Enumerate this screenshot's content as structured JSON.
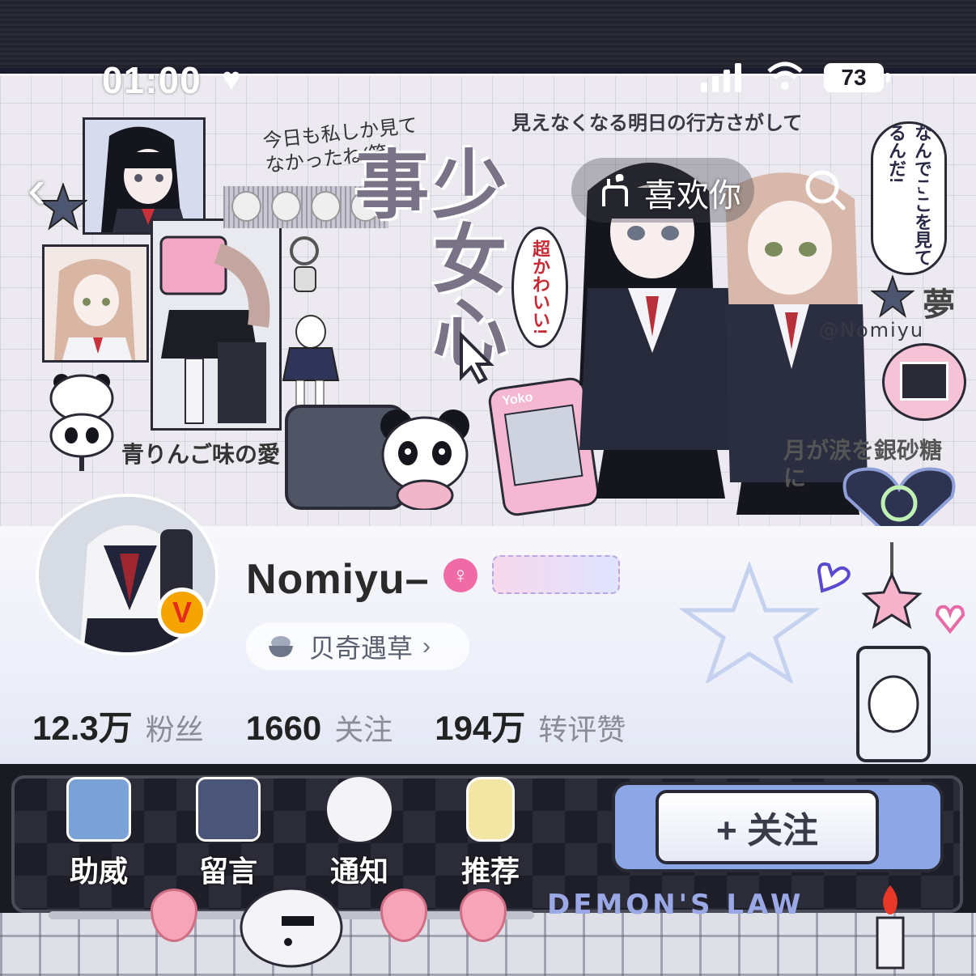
{
  "status_bar": {
    "time": "01:00",
    "battery": "73"
  },
  "nav": {
    "title": "喜欢你",
    "icons": [
      "back-icon",
      "hand-heart-icon",
      "search-icon",
      "more-icon"
    ]
  },
  "banner_art": {
    "handwriting": "今日も私しか見てなかったね(笑)",
    "top_caption": "見えなくなる明日の行方さがして",
    "vertical_title": "少女心事",
    "bubble_left": "超かわいい!",
    "bubble_right": "なんでここを見てるんだ!",
    "kanji_side": "夢",
    "artist_tag": "@Nomiyu",
    "bottom_left_caption": "青りんご味の愛",
    "bottom_right_caption": "月が涙を銀砂糖に",
    "phone_label": "Yoko"
  },
  "profile": {
    "username": "Nomiyu–",
    "verified_badge": "V",
    "gender_icon": "♀",
    "tag_label": "贝奇遇草",
    "stats": [
      {
        "value": "12.3万",
        "label": "粉丝"
      },
      {
        "value": "1660",
        "label": "关注"
      },
      {
        "value": "194万",
        "label": "转评赞"
      }
    ]
  },
  "toolbar": {
    "items": [
      {
        "label": "助威",
        "icon": "camera-sticker-icon"
      },
      {
        "label": "留言",
        "icon": "handheld-console-icon"
      },
      {
        "label": "通知",
        "icon": "puppy-sticker-icon"
      },
      {
        "label": "推荐",
        "icon": "bottle-sticker-icon"
      }
    ],
    "follow_label": "+ 关注",
    "decor_text": "DEMON'S LAW"
  },
  "colors": {
    "accent_pink": "#f06aa6",
    "vip_gold": "#f5a400",
    "follow_frame": "#8ca6e6",
    "dark_bg": "#1a1a22"
  }
}
